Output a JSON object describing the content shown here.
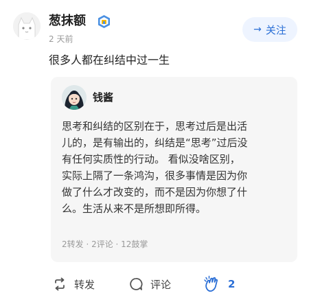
{
  "post": {
    "username": "葱抹额",
    "time_ago": "2 天前",
    "follow_label": "关注",
    "text": "很多人都在纠结中过一生"
  },
  "quoted": {
    "author": "钱酱",
    "lines": [
      "思考和纠结的区别在于，思考过后是出活",
      "儿的，是有输出的，纠结是“思考”过后没",
      "有任何实质性的行动。 看似没啥区别，",
      "实际上隔了一条鸿沟，很多事情是因为你",
      "做了什么才改变的，而不是因为你想了什",
      "么。生活从来不是所想即所得。"
    ],
    "stats": "2转发 · 2评论 · 12鼓掌"
  },
  "actions": {
    "repost_label": "转发",
    "comment_label": "评论",
    "like_count": "2"
  },
  "colors": {
    "accent": "#2b6fd6",
    "follow_bg": "#eef4ff",
    "card_bg": "#f6f6f6",
    "muted": "#9a9a9a"
  }
}
